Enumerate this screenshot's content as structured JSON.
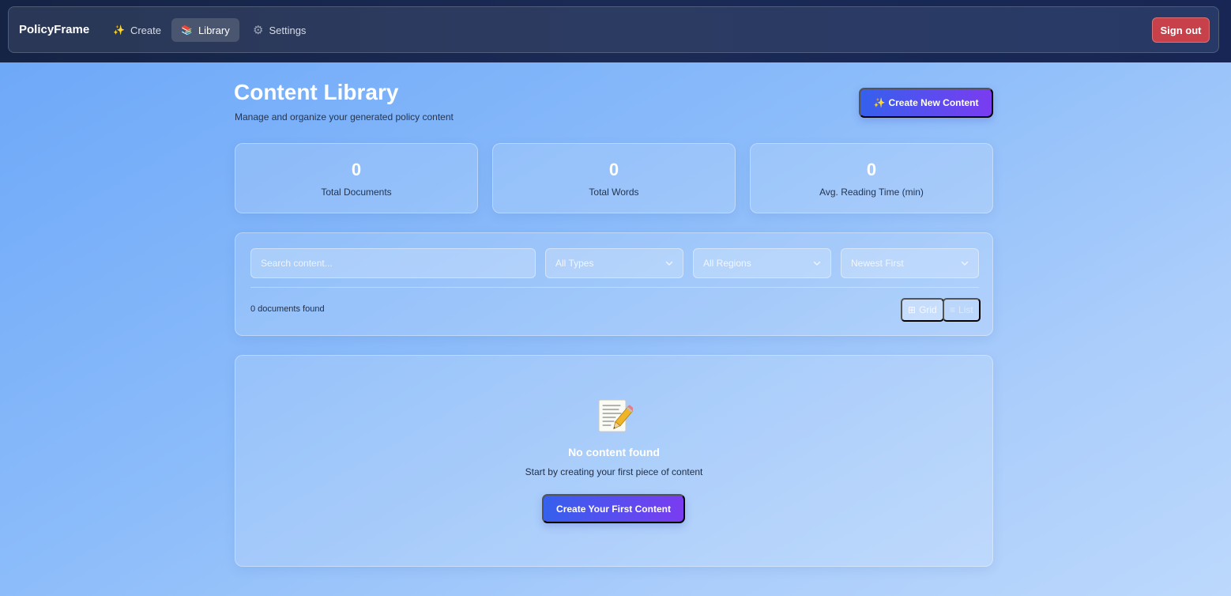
{
  "nav": {
    "brand": "PolicyFrame",
    "items": [
      {
        "label": "Create",
        "icon": "sparkles-icon",
        "glyph": "✨",
        "active": false
      },
      {
        "label": "Library",
        "icon": "books-icon",
        "glyph": "📚",
        "active": true
      },
      {
        "label": "Settings",
        "icon": "gear-icon",
        "glyph": "⚙",
        "active": false
      }
    ],
    "sign_out_label": "Sign out",
    "sign_out_color": "#c7404a"
  },
  "header": {
    "title": "Content Library",
    "subtitle": "Manage and organize your generated policy content",
    "create_button_icon": "✨",
    "create_button_label": "Create New Content"
  },
  "stats": [
    {
      "value": "0",
      "label": "Total Documents"
    },
    {
      "value": "0",
      "label": "Total Words"
    },
    {
      "value": "0",
      "label": "Avg. Reading Time (min)"
    }
  ],
  "filters": {
    "search_placeholder": "Search content...",
    "search_value": "",
    "type_selected": "All Types",
    "region_selected": "All Regions",
    "sort_selected": "Newest First",
    "count_text": "0 documents found",
    "view_grid_icon": "⊞",
    "view_grid_label": "Grid",
    "view_list_icon": "≡",
    "view_list_label": "List",
    "active_view": "Grid"
  },
  "empty_state": {
    "icon": "memo-icon",
    "title": "No content found",
    "description": "Start by creating your first piece of content",
    "button_label": "Create Your First Content"
  },
  "colors": {
    "accent_gradient_start": "#3560ee",
    "accent_gradient_end": "#7a3cf0",
    "background": "#8cbcfa"
  }
}
